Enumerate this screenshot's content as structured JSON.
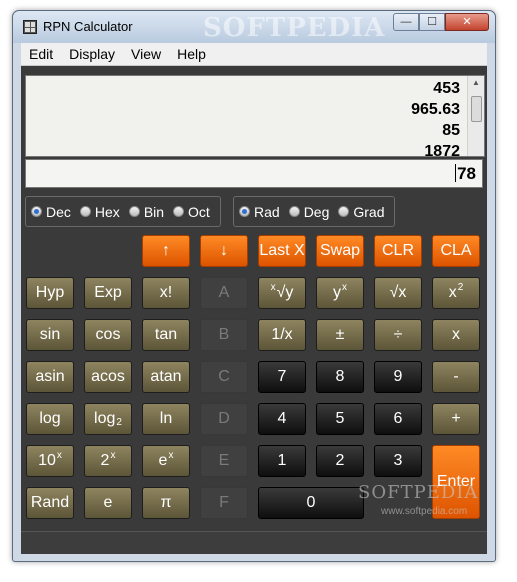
{
  "window": {
    "title": "RPN Calculator",
    "watermark": "SOFTPEDIA"
  },
  "title_buttons": {
    "minimize": "—",
    "maximize": "☐",
    "close": "✕"
  },
  "menu": [
    "Edit",
    "Display",
    "View",
    "Help"
  ],
  "stack": [
    "453",
    "965.63",
    "85",
    "1872"
  ],
  "entry": "78",
  "base_modes": {
    "options": [
      "Dec",
      "Hex",
      "Bin",
      "Oct"
    ],
    "selected": "Dec"
  },
  "angle_modes": {
    "options": [
      "Rad",
      "Deg",
      "Grad"
    ],
    "selected": "Rad"
  },
  "keys": {
    "up": "↑",
    "down": "↓",
    "lastx": "Last X",
    "swap": "Swap",
    "clr": "CLR",
    "cla": "CLA",
    "hyp": "Hyp",
    "exp": "Exp",
    "fact": "x!",
    "A": "A",
    "root_pre": "x",
    "root": "√y",
    "ypow": "y",
    "ypow_sup": "x",
    "sqrt": "√x",
    "sq": "x",
    "sq_sup": "2",
    "sin": "sin",
    "cos": "cos",
    "tan": "tan",
    "B": "B",
    "inv": "1/x",
    "pm": "±",
    "div": "÷",
    "mul": "x",
    "asin": "asin",
    "acos": "acos",
    "atan": "atan",
    "C": "C",
    "d7": "7",
    "d8": "8",
    "d9": "9",
    "sub": "-",
    "log": "log",
    "log2": "log",
    "log2_sub": "2",
    "ln": "ln",
    "D": "D",
    "d4": "4",
    "d5": "5",
    "d6": "6",
    "add": "+",
    "tenx": "10",
    "tenx_sup": "x",
    "twox": "2",
    "twox_sup": "x",
    "ex": "e",
    "ex_sup": "x",
    "E": "E",
    "d1": "1",
    "d2": "2",
    "d3": "3",
    "enter": "Enter",
    "rand": "Rand",
    "e": "e",
    "pi": "π",
    "F": "F",
    "d0": "0"
  },
  "watermark_bottom": {
    "brand": "SOFTPEDIA",
    "url": "www.softpedia.com"
  },
  "colors": {
    "accent": "#ee6a0c",
    "function_key": "#776e4b",
    "digit_key": "#1a1a1a",
    "panel": "#3a3a3a"
  }
}
